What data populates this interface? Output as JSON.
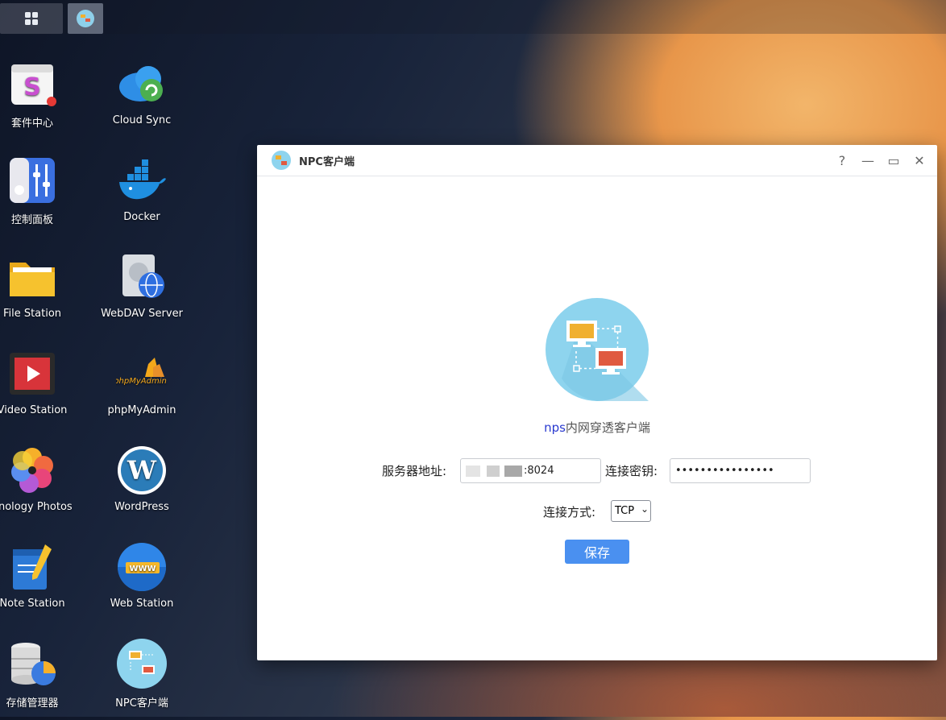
{
  "desktop": {
    "icons": [
      {
        "label": "套件中心",
        "icon": "package-center-icon"
      },
      {
        "label": "Cloud Sync",
        "icon": "cloud-sync-icon"
      },
      {
        "label": "控制面板",
        "icon": "control-panel-icon"
      },
      {
        "label": "Docker",
        "icon": "docker-icon"
      },
      {
        "label": "File Station",
        "icon": "folder-icon"
      },
      {
        "label": "WebDAV Server",
        "icon": "webdav-icon"
      },
      {
        "label": "Video Station",
        "icon": "video-icon"
      },
      {
        "label": "phpMyAdmin",
        "icon": "phpmyadmin-icon"
      },
      {
        "label": "ynology Photos",
        "icon": "photos-icon"
      },
      {
        "label": "WordPress",
        "icon": "wordpress-icon"
      },
      {
        "label": "Note Station",
        "icon": "note-icon"
      },
      {
        "label": "Web Station",
        "icon": "web-station-icon"
      },
      {
        "label": "存储管理器",
        "icon": "storage-manager-icon"
      },
      {
        "label": "NPC客户端",
        "icon": "npc-client-icon"
      }
    ],
    "phpmyadmin_logo_text": "phpMyAdmin",
    "web_station_badge": "WWW"
  },
  "window": {
    "title": "NPC客户端",
    "controls": {
      "help": "?",
      "minimize": "—",
      "maximize": "▭",
      "close": "✕"
    },
    "subtitle_brand": "nps",
    "subtitle_rest": "内网穿透客户端",
    "server_label": "服务器地址:",
    "server_value": ":8024",
    "key_label": "连接密钥:",
    "key_value": "••••••••••••••••",
    "mode_label": "连接方式:",
    "mode_value": "TCP",
    "save_label": "保存"
  },
  "colors": {
    "accent": "#4a90f0",
    "brand_text": "#2a3ad0"
  }
}
